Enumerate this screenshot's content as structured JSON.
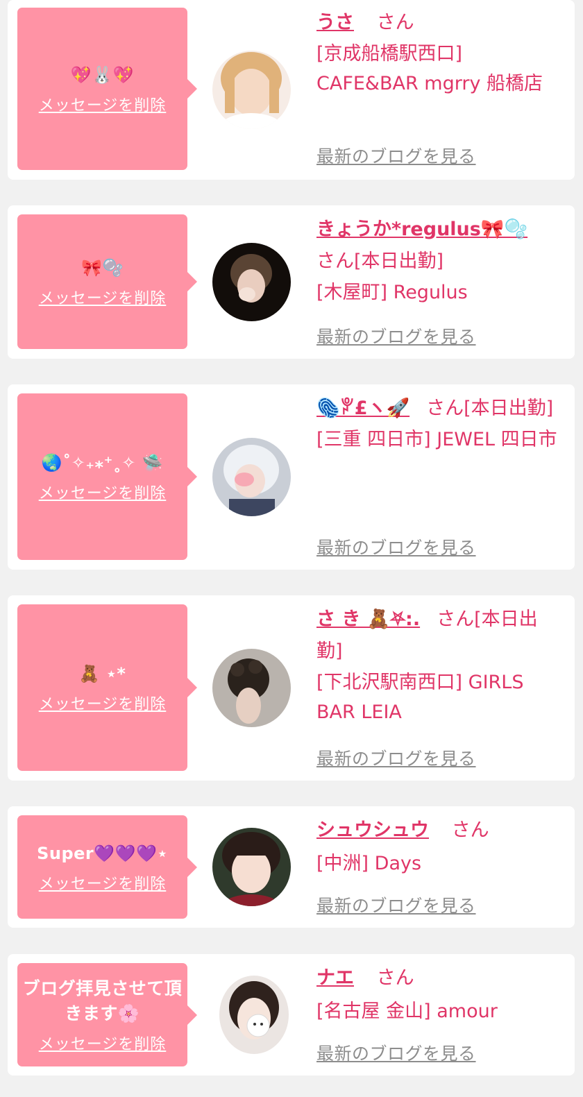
{
  "items": [
    {
      "message": "💖🐰💖",
      "delete_label": "メッセージを削除",
      "name": "うさ",
      "suffix": "さん",
      "tag": "",
      "shop": "[京成船橋駅西口] CAFE&BAR mgrry 船橋店",
      "blog_label": "最新のブログを見る",
      "avatar_colors": [
        "#f3d6a8",
        "#e8b98a"
      ]
    },
    {
      "message": "🎀🫧",
      "delete_label": "メッセージを削除",
      "name": "きょうか*regulus🎀🫧",
      "suffix": "さん",
      "tag": "[本日出勤]",
      "shop": "[木屋町] Regulus",
      "blog_label": "最新のブログを見る",
      "avatar_colors": [
        "#1c1410",
        "#4a3020"
      ]
    },
    {
      "message": "🌏˚✧₊⁎⁺˳✧ 🛸",
      "delete_label": "メッセージを削除",
      "name": "🫆ꐕ£ヽ🚀",
      "suffix": "さん",
      "tag": "[本日出勤]",
      "shop": "[三重 四日市] JEWEL 四日市",
      "blog_label": "最新のブログを見る",
      "avatar_colors": [
        "#dfe6ee",
        "#9aa7b8"
      ]
    },
    {
      "message": "🧸 ⋆*",
      "delete_label": "メッセージを削除",
      "name": "さ き 🧸⛧:.",
      "suffix": "さん",
      "tag": "[本日出勤]",
      "shop": "[下北沢駅南西口] GIRLS BAR LEIA",
      "blog_label": "最新のブログを見る",
      "avatar_colors": [
        "#8a7a6c",
        "#2b241e"
      ]
    },
    {
      "message": "Super💜💜💜⋆",
      "delete_label": "メッセージを削除",
      "name": "シュウシュウ",
      "suffix": "さん",
      "tag": "",
      "shop": "[中洲] Days",
      "blog_label": "最新のブログを見る",
      "avatar_colors": [
        "#f5dccd",
        "#3b2a24"
      ]
    },
    {
      "message": "ブログ拝見させて頂きます🌸",
      "delete_label": "メッセージを削除",
      "name": "ナエ",
      "suffix": "さん",
      "tag": "",
      "shop": "[名古屋 金山] amour",
      "blog_label": "最新のブログを見る",
      "avatar_colors": [
        "#f0e3dc",
        "#3a2a25"
      ]
    }
  ]
}
